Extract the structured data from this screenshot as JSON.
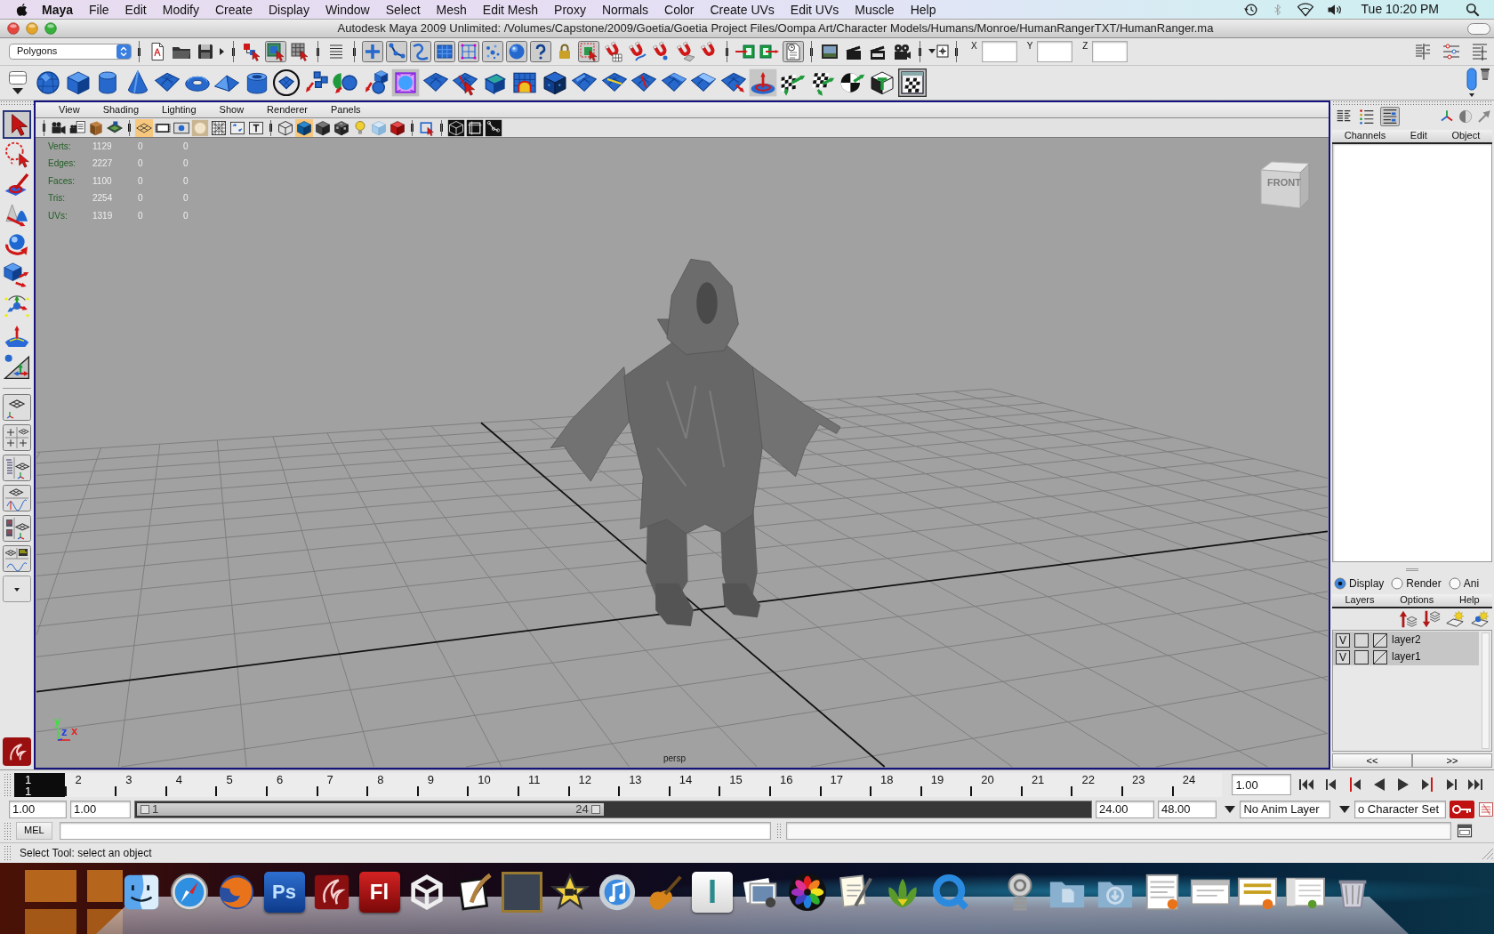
{
  "menu_bar": {
    "app": "Maya",
    "items": [
      "File",
      "Edit",
      "Modify",
      "Create",
      "Display",
      "Window",
      "Select",
      "Mesh",
      "Edit Mesh",
      "Proxy",
      "Normals",
      "Color",
      "Create UVs",
      "Edit UVs",
      "Muscle",
      "Help"
    ],
    "clock": "Tue 10:20 PM"
  },
  "window": {
    "title": "Autodesk Maya 2009 Unlimited: /Volumes/Capstone/2009/Goetia/Goetia Project Files/Oompa Art/Character Models/Humans/Monroe/HumanRangerTXT/HumanRanger.ma"
  },
  "status_line": {
    "menu_set": "Polygons",
    "buttons": [
      {
        "on": false
      },
      {
        "on": false
      },
      {
        "on": false
      },
      {
        "on": false
      },
      {
        "on": true
      },
      {
        "on": false
      },
      {
        "on": false
      },
      {
        "on": true
      },
      {
        "on": true
      },
      {
        "on": true
      },
      {
        "on": true
      },
      {
        "on": true
      },
      {
        "on": true
      },
      {
        "on": true
      },
      {
        "on": true
      },
      {
        "on": false
      },
      {
        "on": true
      },
      {
        "on": false
      },
      {
        "on": false
      },
      {
        "on": false
      },
      {
        "on": false
      },
      {
        "on": false
      },
      {
        "on": false
      },
      {
        "on": false
      },
      {
        "on": true
      },
      {
        "on": false
      },
      {
        "on": false
      },
      {
        "on": false
      },
      {
        "on": false
      },
      {
        "on": false
      },
      {
        "on": false
      },
      {
        "on": false
      },
      {
        "on": false
      }
    ],
    "coordinate_fields": [
      {
        "label": "X"
      },
      {
        "label": "Y"
      },
      {
        "label": "Z"
      }
    ]
  },
  "toolbox": {
    "tools": [
      {
        "selected": true
      },
      {
        "selected": false
      },
      {
        "selected": false
      },
      {
        "selected": false
      },
      {
        "selected": false
      },
      {
        "selected": false
      },
      {
        "selected": false
      },
      {
        "selected": false
      },
      {
        "selected": false
      }
    ]
  },
  "viewport": {
    "menus": [
      "View",
      "Shading",
      "Lighting",
      "Show",
      "Renderer",
      "Panels"
    ],
    "toolbar": [
      {
        "on": false
      },
      {
        "on": false
      },
      {
        "on": false
      },
      {
        "on": false
      },
      {
        "on": true
      },
      {
        "on": false
      },
      {
        "on": false
      },
      {
        "on": false
      },
      {
        "on": false
      },
      {
        "on": false
      },
      {
        "on": false
      },
      {
        "on": false
      },
      {
        "on": true
      },
      {
        "on": false
      },
      {
        "on": false
      },
      {
        "on": false
      },
      {
        "on": false
      },
      {
        "on": false
      },
      {
        "on": false
      },
      {
        "on": false
      },
      {
        "on": false
      },
      {
        "on": false
      }
    ],
    "hud": [
      {
        "label": "Verts:",
        "values": [
          "1129",
          "0",
          "0"
        ]
      },
      {
        "label": "Edges:",
        "values": [
          "2227",
          "0",
          "0"
        ]
      },
      {
        "label": "Faces:",
        "values": [
          "1100",
          "0",
          "0"
        ]
      },
      {
        "label": "Tris:",
        "values": [
          "2254",
          "0",
          "0"
        ]
      },
      {
        "label": "UVs:",
        "values": [
          "1319",
          "0",
          "0"
        ]
      }
    ],
    "view_cube": "FRONT",
    "axis_indicator": [
      {
        "label": "y",
        "color": "#3ce03c"
      },
      {
        "label": "z",
        "color": "#2040e0"
      },
      {
        "label": "x",
        "color": "#e82020"
      }
    ],
    "camera": "persp"
  },
  "channel_box": {
    "view_toggles": [
      {
        "on": false
      },
      {
        "on": false
      },
      {
        "on": true
      }
    ],
    "menus": [
      "Channels",
      "Edit",
      "Object"
    ]
  },
  "layer_editor": {
    "modes": [
      {
        "label": "Display",
        "selected": true
      },
      {
        "label": "Render",
        "selected": false
      },
      {
        "label": "Ani",
        "selected": false
      }
    ],
    "menus": [
      "Layers",
      "Options",
      "Help"
    ],
    "layers": [
      {
        "visibility": "V",
        "name": "layer2"
      },
      {
        "visibility": "V",
        "name": "layer1"
      }
    ],
    "nav": [
      "<<",
      ">>"
    ]
  },
  "time_slider": {
    "frames": [
      {
        "label": "1",
        "selected": true
      },
      {
        "label": "2",
        "selected": false
      },
      {
        "label": "3",
        "selected": false
      },
      {
        "label": "4",
        "selected": false
      },
      {
        "label": "5",
        "selected": false
      },
      {
        "label": "6",
        "selected": false
      },
      {
        "label": "7",
        "selected": false
      },
      {
        "label": "8",
        "selected": false
      },
      {
        "label": "9",
        "selected": false
      },
      {
        "label": "10",
        "selected": false
      },
      {
        "label": "11",
        "selected": false
      },
      {
        "label": "12",
        "selected": false
      },
      {
        "label": "13",
        "selected": false
      },
      {
        "label": "14",
        "selected": false
      },
      {
        "label": "15",
        "selected": false
      },
      {
        "label": "16",
        "selected": false
      },
      {
        "label": "17",
        "selected": false
      },
      {
        "label": "18",
        "selected": false
      },
      {
        "label": "19",
        "selected": false
      },
      {
        "label": "20",
        "selected": false
      },
      {
        "label": "21",
        "selected": false
      },
      {
        "label": "22",
        "selected": false
      },
      {
        "label": "23",
        "selected": false
      },
      {
        "label": "24",
        "selected": false
      }
    ],
    "current_frame": "1",
    "current_time": "1.00"
  },
  "range_slider": {
    "start_time": "1.00",
    "range_start": "1.00",
    "handle_start": "1",
    "handle_end": "24",
    "level": 0.49,
    "range_end": "24.00",
    "end_time": "48.00",
    "anim_layer": "No Anim Layer",
    "character_set": "o Character Set"
  },
  "command_line": {
    "language": "MEL"
  },
  "help_line": {
    "text": "Select Tool: select an object"
  },
  "dock": {
    "tiles": [
      "Ps",
      "Fl",
      "I"
    ]
  }
}
